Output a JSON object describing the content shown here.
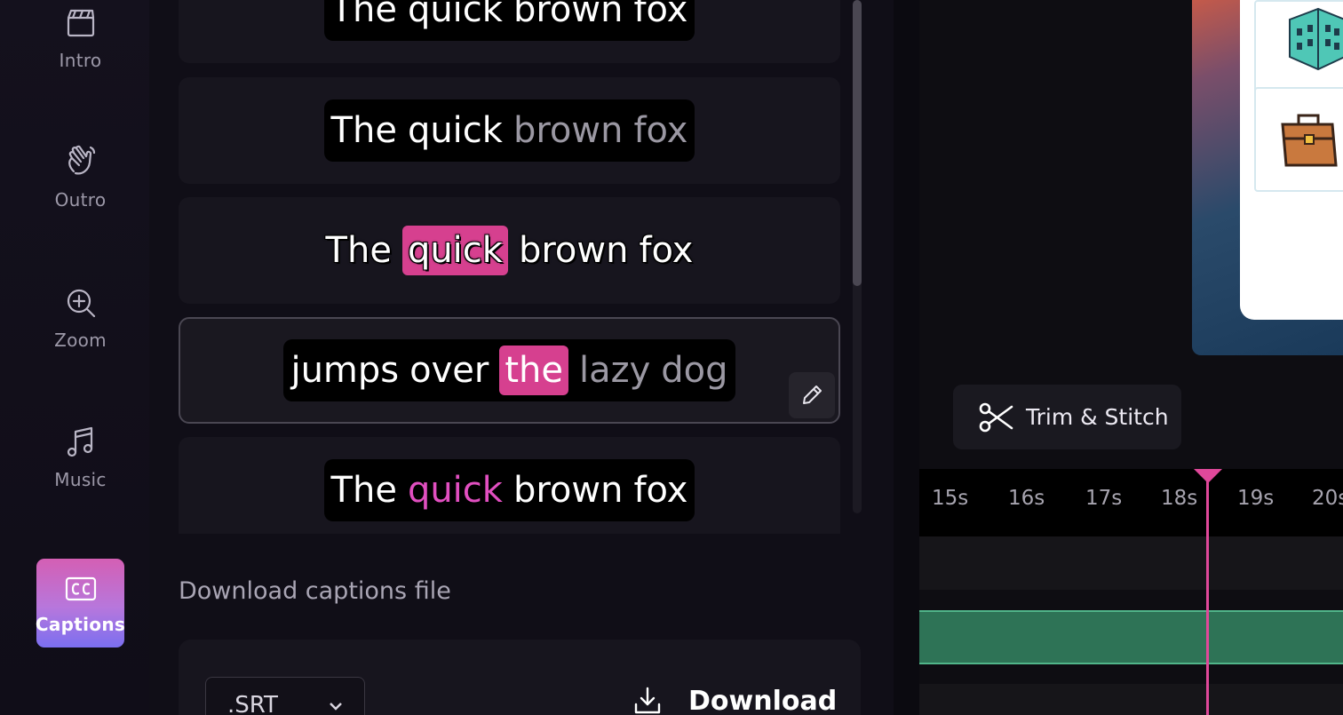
{
  "sidebar": {
    "items": [
      {
        "label": "Intro",
        "icon": "clapperboard-icon"
      },
      {
        "label": "Outro",
        "icon": "wave-hand-icon"
      },
      {
        "label": "Zoom",
        "icon": "zoom-in-icon"
      },
      {
        "label": "Music",
        "icon": "music-note-icon"
      },
      {
        "label": "Captions",
        "icon": "closed-captions-icon",
        "active": true
      }
    ]
  },
  "captions": {
    "styles": [
      {
        "words": [
          "The",
          "quick",
          "brown",
          "fox"
        ]
      },
      {
        "words": [
          "The",
          "quick",
          "brown",
          "fox"
        ]
      },
      {
        "words": [
          "The",
          "quick",
          "brown",
          "fox"
        ]
      },
      {
        "words": [
          "jumps",
          "over",
          "the",
          "lazy",
          "dog"
        ],
        "selected": true
      },
      {
        "words": [
          "The",
          "quick",
          "brown",
          "fox"
        ]
      }
    ],
    "highlight_color": "#d6408f",
    "accent_text_color": "#e14fc0"
  },
  "download": {
    "title": "Download captions file",
    "format": ".SRT",
    "button_label": "Download"
  },
  "editor": {
    "trim_button_label": "Trim & Stitch",
    "ruler_ticks": [
      "15s",
      "16s",
      "17s",
      "18s",
      "19s",
      "20s"
    ],
    "playhead_color": "#e0489a",
    "clip_color": "#2e7356"
  }
}
